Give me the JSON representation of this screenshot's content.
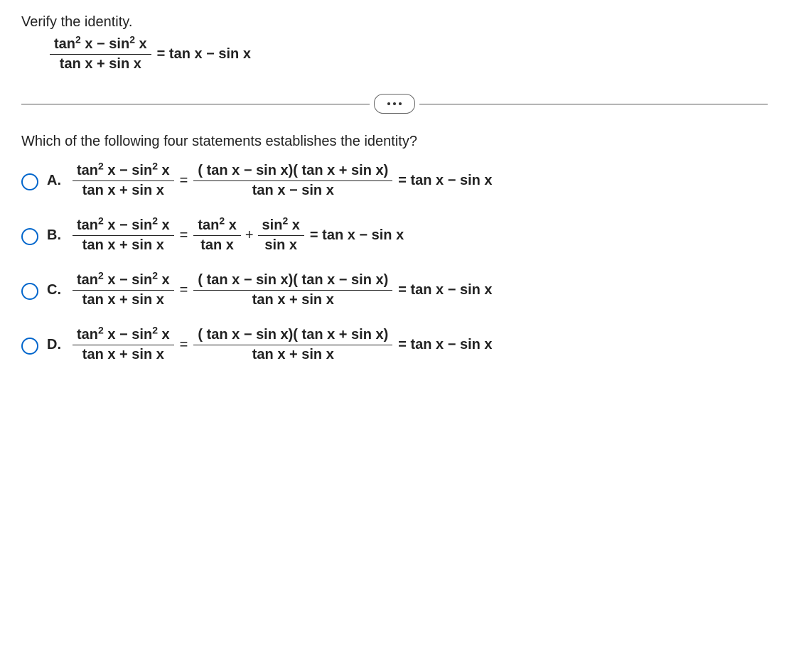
{
  "heading": "Verify the identity.",
  "identity": {
    "lhs_num": "tan² x − sin² x",
    "lhs_den": "tan x + sin x",
    "equals": "=",
    "rhs": "tan x − sin x"
  },
  "question": "Which of the following four statements establishes the identity?",
  "options": {
    "A": {
      "label": "A.",
      "step_num": "( tan x − sin x)( tan x + sin x)",
      "step_den": "tan x − sin x",
      "result": "= tan x − sin x"
    },
    "B": {
      "label": "B.",
      "term1_num": "tan² x",
      "term1_den": "tan x",
      "term2_num": "sin² x",
      "term2_den": "sin x",
      "result": "= tan x − sin x"
    },
    "C": {
      "label": "C.",
      "step_num": "( tan x − sin x)( tan x − sin x)",
      "step_den": "tan x + sin x",
      "result": "= tan x − sin x"
    },
    "D": {
      "label": "D.",
      "step_num": "( tan x − sin x)( tan x + sin x)",
      "step_den": "tan x + sin x",
      "result": "= tan x − sin x"
    }
  },
  "common": {
    "lhs_num_html": "tan<sup>2</sup> x − sin<sup>2</sup> x",
    "lhs_den_html": "tan x + sin x"
  }
}
